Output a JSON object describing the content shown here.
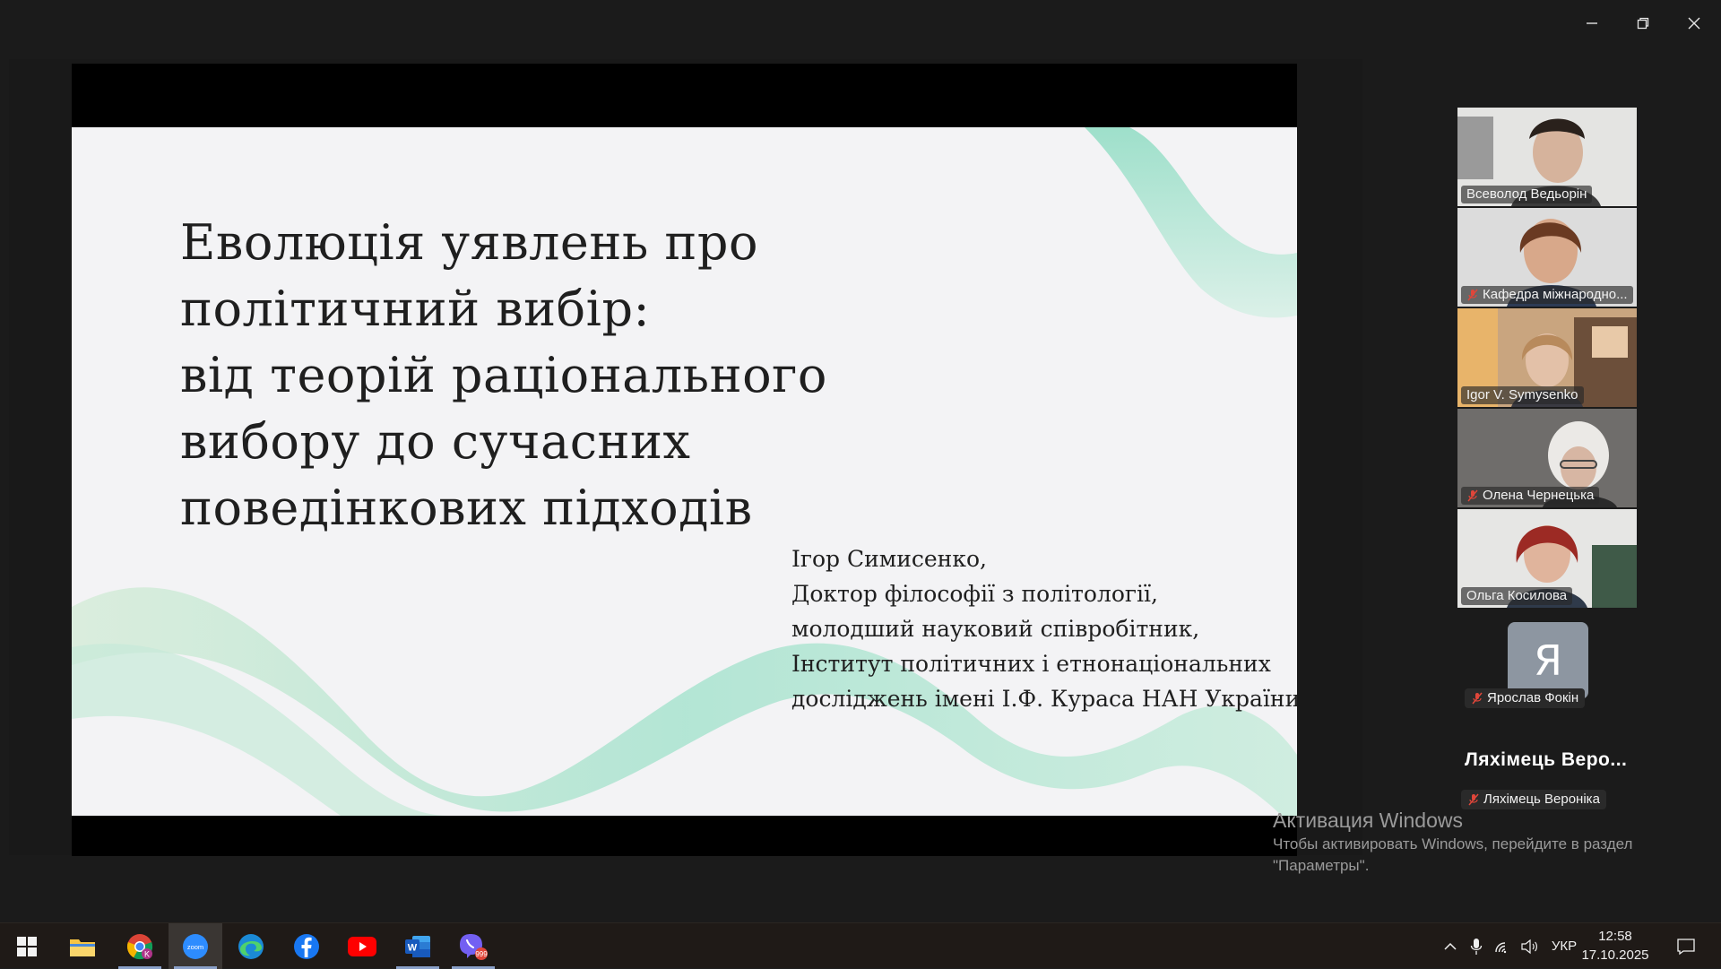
{
  "window_controls": {
    "minimize_icon": "minimize-icon",
    "restore_icon": "restore-icon",
    "close_icon": "close-icon"
  },
  "slide": {
    "title_lines": [
      "Еволюція уявлень про",
      "політичний вибір:",
      "від теорій раціонального",
      "вибору до сучасних",
      "поведінкових підходів"
    ],
    "author_lines": [
      "Ігор Симисенко,",
      "Доктор філософії з політології,",
      "молодший науковий співробітник,",
      "Інститут політичних і етнонаціональних",
      "досліджень імені І.Ф. Кураса НАН України"
    ],
    "accent_color": "#a8e3cf"
  },
  "participants": [
    {
      "name": "Всеволод Ведьорін",
      "muted": false,
      "active_speaker": false
    },
    {
      "name": "Кафедра міжнародно...",
      "muted": true,
      "active_speaker": false
    },
    {
      "name": "Igor V. Symysenko",
      "muted": false,
      "active_speaker": true
    },
    {
      "name": "Олена Чернецька",
      "muted": true,
      "active_speaker": false
    },
    {
      "name": "Ольга Косилова",
      "muted": false,
      "active_speaker": false
    }
  ],
  "avatar_participant": {
    "initial": "Я",
    "name": "Ярослав Фокін",
    "muted": true
  },
  "no_video_participant": {
    "display_name": "Ляхімець Веро...",
    "name": "Ляхімець Вероніка",
    "muted": true
  },
  "activation": {
    "title": "Активация Windows",
    "line1": "Чтобы активировать Windows, перейдите в раздел",
    "line2": "\"Параметры\"."
  },
  "taskbar": {
    "apps": [
      "windows-start-icon",
      "file-explorer-icon",
      "chrome-icon",
      "zoom-icon",
      "edge-icon",
      "facebook-icon",
      "youtube-icon",
      "word-icon",
      "viber-icon"
    ],
    "zoom_label": "zoom",
    "chrome_badge": "K",
    "viber_badge": "999",
    "language": "УКР",
    "time": "12:58",
    "date": "17.10.2025"
  },
  "colors": {
    "active_speaker_border": "#2fd982",
    "muted_icon": "#e0463a",
    "taskbar_bg": "#1f1a17"
  }
}
